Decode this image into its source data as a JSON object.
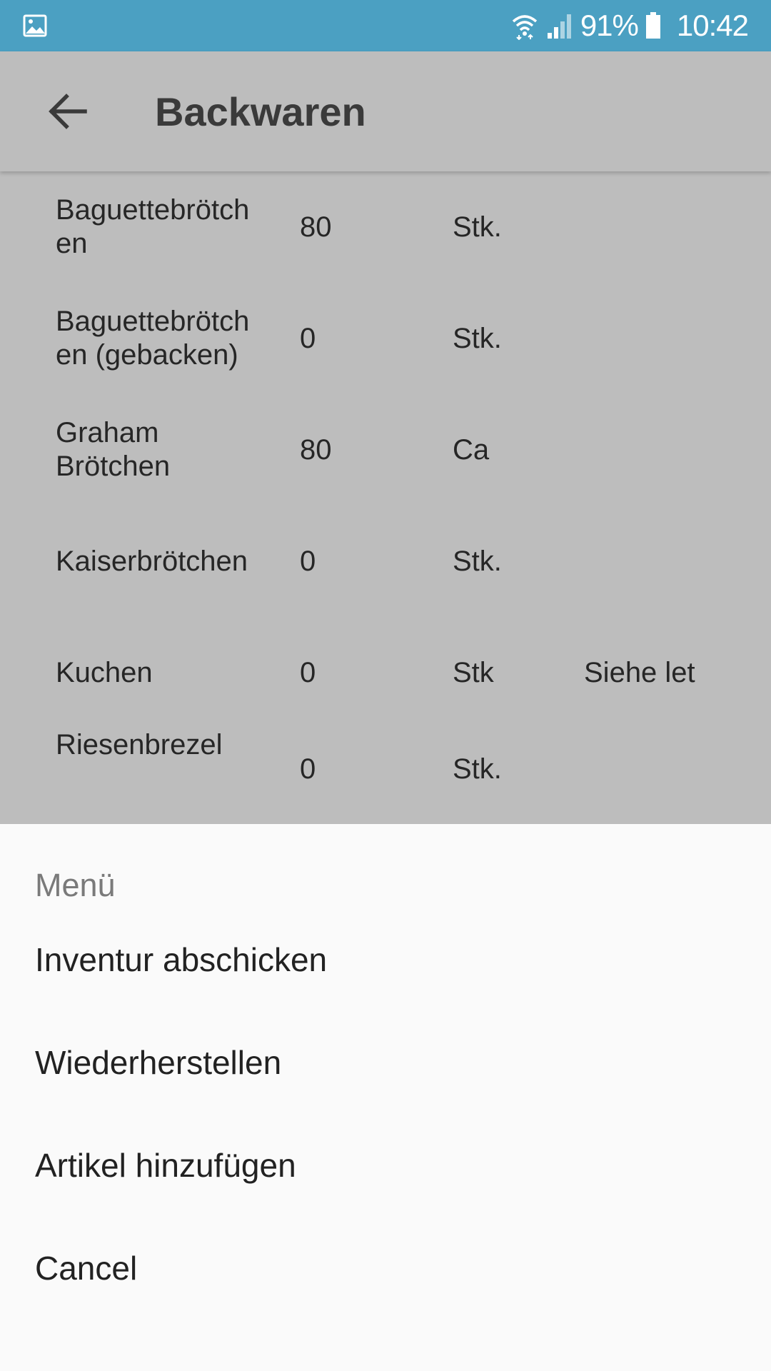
{
  "status_bar": {
    "battery": "91%",
    "time": "10:42",
    "icons": [
      "gallery-icon",
      "wifi-icon",
      "signal-icon",
      "battery-icon"
    ],
    "color": "#4ba0c2"
  },
  "app_bar": {
    "title": "Backwaren",
    "back_icon": "arrow-left-icon"
  },
  "list": {
    "rows": [
      {
        "name": "Baguettebrötch en",
        "qty": "80",
        "unit": "Stk.",
        "note": ""
      },
      {
        "name": "Baguettebrötch en (gebacken)",
        "qty": "0",
        "unit": "Stk.",
        "note": ""
      },
      {
        "name": "Graham Brötchen",
        "qty": "80",
        "unit": "Ca",
        "note": ""
      },
      {
        "name": "Kaiserbrötchen",
        "qty": "0",
        "unit": "Stk.",
        "note": ""
      },
      {
        "name": "Kuchen",
        "qty": "0",
        "unit": "Stk",
        "note": "Siehe let"
      },
      {
        "name": "Riesenbrezel",
        "qty": "0",
        "unit": "Stk.",
        "note": ""
      }
    ]
  },
  "sheet": {
    "title": "Menü",
    "items": [
      {
        "label": "Inventur abschicken"
      },
      {
        "label": "Wiederherstellen"
      },
      {
        "label": "Artikel hinzufügen"
      },
      {
        "label": "Cancel"
      }
    ]
  }
}
